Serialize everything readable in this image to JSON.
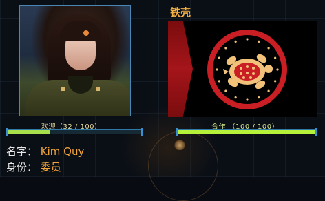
{
  "character": {
    "favor_label": "欢迎（32 / 100）",
    "favor_value": 32,
    "favor_max": 100,
    "name_key": "名字：",
    "name_value": "Kim Quy",
    "role_key": "身份：",
    "role_value": "委员"
  },
  "faction": {
    "title": "铁壳",
    "cooperation_label": "合作 （100 / 100）",
    "cooperation_value": 100,
    "cooperation_max": 100,
    "emblem_icon": "turtle-emblem-icon"
  },
  "colors": {
    "favor_fill": "#a7e04a",
    "coop_fill": "#b6f23a",
    "accent_orange": "#f2a43a",
    "emblem_red": "#c81e24",
    "emblem_gold": "#f2c27a"
  }
}
